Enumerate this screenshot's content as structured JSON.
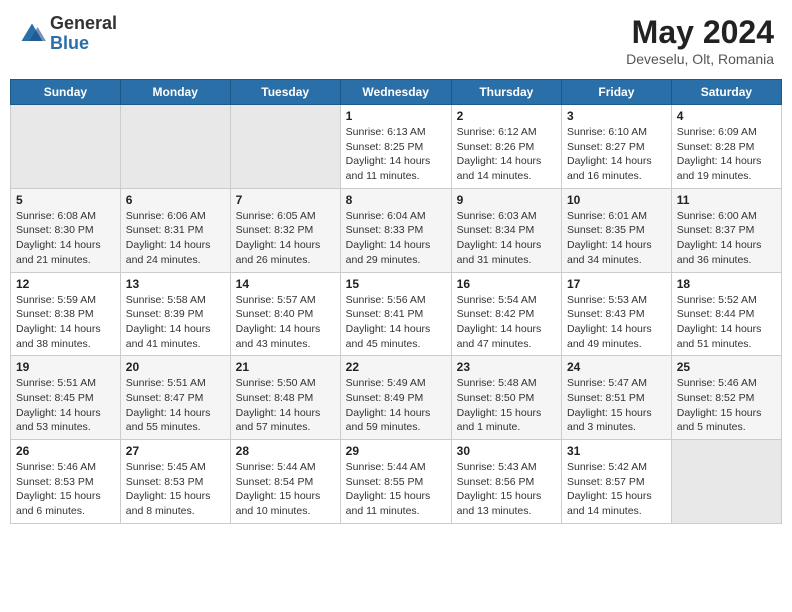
{
  "header": {
    "logo_general": "General",
    "logo_blue": "Blue",
    "title": "May 2024",
    "location": "Deveselu, Olt, Romania"
  },
  "days_of_week": [
    "Sunday",
    "Monday",
    "Tuesday",
    "Wednesday",
    "Thursday",
    "Friday",
    "Saturday"
  ],
  "weeks": [
    [
      {
        "day": "",
        "info": ""
      },
      {
        "day": "",
        "info": ""
      },
      {
        "day": "",
        "info": ""
      },
      {
        "day": "1",
        "info": "Sunrise: 6:13 AM\nSunset: 8:25 PM\nDaylight: 14 hours\nand 11 minutes."
      },
      {
        "day": "2",
        "info": "Sunrise: 6:12 AM\nSunset: 8:26 PM\nDaylight: 14 hours\nand 14 minutes."
      },
      {
        "day": "3",
        "info": "Sunrise: 6:10 AM\nSunset: 8:27 PM\nDaylight: 14 hours\nand 16 minutes."
      },
      {
        "day": "4",
        "info": "Sunrise: 6:09 AM\nSunset: 8:28 PM\nDaylight: 14 hours\nand 19 minutes."
      }
    ],
    [
      {
        "day": "5",
        "info": "Sunrise: 6:08 AM\nSunset: 8:30 PM\nDaylight: 14 hours\nand 21 minutes."
      },
      {
        "day": "6",
        "info": "Sunrise: 6:06 AM\nSunset: 8:31 PM\nDaylight: 14 hours\nand 24 minutes."
      },
      {
        "day": "7",
        "info": "Sunrise: 6:05 AM\nSunset: 8:32 PM\nDaylight: 14 hours\nand 26 minutes."
      },
      {
        "day": "8",
        "info": "Sunrise: 6:04 AM\nSunset: 8:33 PM\nDaylight: 14 hours\nand 29 minutes."
      },
      {
        "day": "9",
        "info": "Sunrise: 6:03 AM\nSunset: 8:34 PM\nDaylight: 14 hours\nand 31 minutes."
      },
      {
        "day": "10",
        "info": "Sunrise: 6:01 AM\nSunset: 8:35 PM\nDaylight: 14 hours\nand 34 minutes."
      },
      {
        "day": "11",
        "info": "Sunrise: 6:00 AM\nSunset: 8:37 PM\nDaylight: 14 hours\nand 36 minutes."
      }
    ],
    [
      {
        "day": "12",
        "info": "Sunrise: 5:59 AM\nSunset: 8:38 PM\nDaylight: 14 hours\nand 38 minutes."
      },
      {
        "day": "13",
        "info": "Sunrise: 5:58 AM\nSunset: 8:39 PM\nDaylight: 14 hours\nand 41 minutes."
      },
      {
        "day": "14",
        "info": "Sunrise: 5:57 AM\nSunset: 8:40 PM\nDaylight: 14 hours\nand 43 minutes."
      },
      {
        "day": "15",
        "info": "Sunrise: 5:56 AM\nSunset: 8:41 PM\nDaylight: 14 hours\nand 45 minutes."
      },
      {
        "day": "16",
        "info": "Sunrise: 5:54 AM\nSunset: 8:42 PM\nDaylight: 14 hours\nand 47 minutes."
      },
      {
        "day": "17",
        "info": "Sunrise: 5:53 AM\nSunset: 8:43 PM\nDaylight: 14 hours\nand 49 minutes."
      },
      {
        "day": "18",
        "info": "Sunrise: 5:52 AM\nSunset: 8:44 PM\nDaylight: 14 hours\nand 51 minutes."
      }
    ],
    [
      {
        "day": "19",
        "info": "Sunrise: 5:51 AM\nSunset: 8:45 PM\nDaylight: 14 hours\nand 53 minutes."
      },
      {
        "day": "20",
        "info": "Sunrise: 5:51 AM\nSunset: 8:47 PM\nDaylight: 14 hours\nand 55 minutes."
      },
      {
        "day": "21",
        "info": "Sunrise: 5:50 AM\nSunset: 8:48 PM\nDaylight: 14 hours\nand 57 minutes."
      },
      {
        "day": "22",
        "info": "Sunrise: 5:49 AM\nSunset: 8:49 PM\nDaylight: 14 hours\nand 59 minutes."
      },
      {
        "day": "23",
        "info": "Sunrise: 5:48 AM\nSunset: 8:50 PM\nDaylight: 15 hours\nand 1 minute."
      },
      {
        "day": "24",
        "info": "Sunrise: 5:47 AM\nSunset: 8:51 PM\nDaylight: 15 hours\nand 3 minutes."
      },
      {
        "day": "25",
        "info": "Sunrise: 5:46 AM\nSunset: 8:52 PM\nDaylight: 15 hours\nand 5 minutes."
      }
    ],
    [
      {
        "day": "26",
        "info": "Sunrise: 5:46 AM\nSunset: 8:53 PM\nDaylight: 15 hours\nand 6 minutes."
      },
      {
        "day": "27",
        "info": "Sunrise: 5:45 AM\nSunset: 8:53 PM\nDaylight: 15 hours\nand 8 minutes."
      },
      {
        "day": "28",
        "info": "Sunrise: 5:44 AM\nSunset: 8:54 PM\nDaylight: 15 hours\nand 10 minutes."
      },
      {
        "day": "29",
        "info": "Sunrise: 5:44 AM\nSunset: 8:55 PM\nDaylight: 15 hours\nand 11 minutes."
      },
      {
        "day": "30",
        "info": "Sunrise: 5:43 AM\nSunset: 8:56 PM\nDaylight: 15 hours\nand 13 minutes."
      },
      {
        "day": "31",
        "info": "Sunrise: 5:42 AM\nSunset: 8:57 PM\nDaylight: 15 hours\nand 14 minutes."
      },
      {
        "day": "",
        "info": ""
      }
    ]
  ]
}
